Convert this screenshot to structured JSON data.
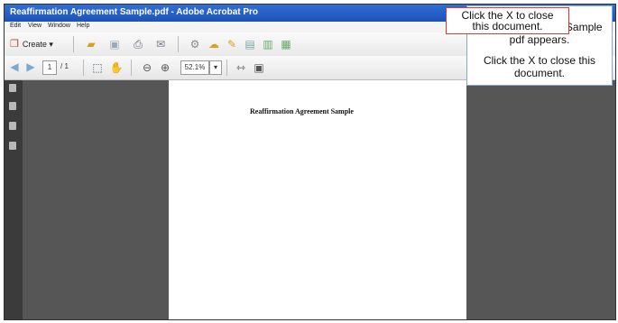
{
  "window": {
    "title": "Reaffirmation Agreement Sample.pdf - Adobe Acrobat Pro",
    "menu": [
      "Edit",
      "View",
      "Window",
      "Help"
    ]
  },
  "toolbar": {
    "create_label": "Create",
    "page_number": "1",
    "page_total": "/ 1",
    "zoom_value": "52.1%"
  },
  "document": {
    "page_heading": "Reaffirmation Agreement Sample"
  },
  "callouts": {
    "top": {
      "line1": "Click the X to close",
      "line2": "this document."
    },
    "main": {
      "line1": "The Reaffirmation Sample",
      "line2": "pdf appears.",
      "line3": "Click the X to close this",
      "line4": "document."
    }
  },
  "colors": {
    "titlebar": "#1d52b8",
    "workspace": "#565656",
    "callout_border": "#d23b3b"
  }
}
